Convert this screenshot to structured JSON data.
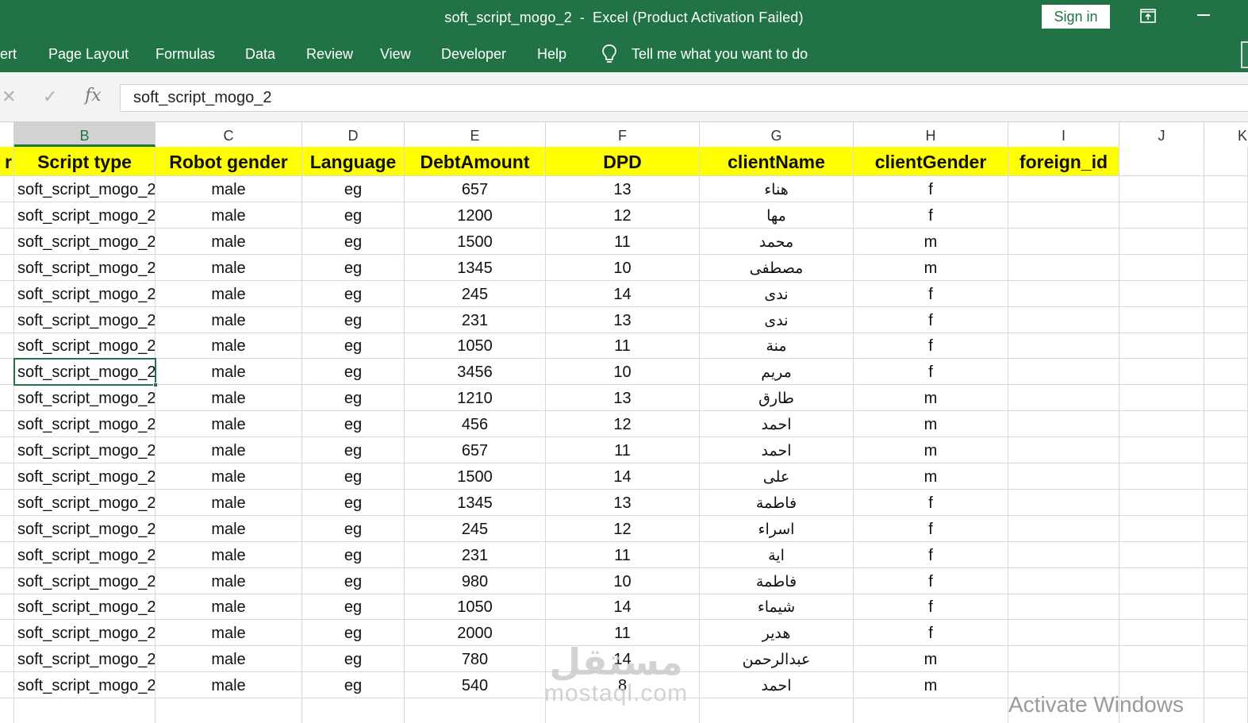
{
  "titlebar": {
    "file_name": "soft_script_mogo_2",
    "app_status": "Excel (Product Activation Failed)",
    "sign_in_label": "Sign in",
    "icons": [
      "restore-window-icon",
      "minimize-icon"
    ]
  },
  "ribbon": {
    "tabs": [
      "ert",
      "Page Layout",
      "Formulas",
      "Data",
      "Review",
      "View",
      "Developer",
      "Help"
    ],
    "tell_me": "Tell me what you want to do",
    "tell_me_icon": "lightbulb-icon"
  },
  "formula_bar": {
    "value": "soft_script_mogo_2",
    "cancel_icon": "cancel-x-icon",
    "enter_icon": "checkmark-icon",
    "fx_label": "fx"
  },
  "columns": [
    "B",
    "C",
    "D",
    "E",
    "F",
    "G",
    "H",
    "I",
    "J",
    "K"
  ],
  "selected_column": "B",
  "sheet": {
    "header_cut_left": "r",
    "headers": [
      "Script type",
      "Robot gender",
      "Language",
      "DebtAmount",
      "DPD",
      "clientName",
      "clientGender",
      "foreign_id"
    ],
    "rows": [
      [
        "soft_script_mogo_2",
        "male",
        "eg",
        "657",
        "13",
        "هناء",
        "f"
      ],
      [
        "soft_script_mogo_2",
        "male",
        "eg",
        "1200",
        "12",
        "مها",
        "f"
      ],
      [
        "soft_script_mogo_2",
        "male",
        "eg",
        "1500",
        "11",
        "محمد",
        "m"
      ],
      [
        "soft_script_mogo_2",
        "male",
        "eg",
        "1345",
        "10",
        "مصطفى",
        "m"
      ],
      [
        "soft_script_mogo_2",
        "male",
        "eg",
        "245",
        "14",
        "ندى",
        "f"
      ],
      [
        "soft_script_mogo_2",
        "male",
        "eg",
        "231",
        "13",
        "ندى",
        "f"
      ],
      [
        "soft_script_mogo_2",
        "male",
        "eg",
        "1050",
        "11",
        "منة",
        "f"
      ],
      [
        "soft_script_mogo_2",
        "male",
        "eg",
        "3456",
        "10",
        "مريم",
        "f"
      ],
      [
        "soft_script_mogo_2",
        "male",
        "eg",
        "1210",
        "13",
        "طارق",
        "m"
      ],
      [
        "soft_script_mogo_2",
        "male",
        "eg",
        "456",
        "12",
        "احمد",
        "m"
      ],
      [
        "soft_script_mogo_2",
        "male",
        "eg",
        "657",
        "11",
        "احمد",
        "m"
      ],
      [
        "soft_script_mogo_2",
        "male",
        "eg",
        "1500",
        "14",
        "على",
        "m"
      ],
      [
        "soft_script_mogo_2",
        "male",
        "eg",
        "1345",
        "13",
        "فاطمة",
        "f"
      ],
      [
        "soft_script_mogo_2",
        "male",
        "eg",
        "245",
        "12",
        "اسراء",
        "f"
      ],
      [
        "soft_script_mogo_2",
        "male",
        "eg",
        "231",
        "11",
        "اية",
        "f"
      ],
      [
        "soft_script_mogo_2",
        "male",
        "eg",
        "980",
        "10",
        "فاطمة",
        "f"
      ],
      [
        "soft_script_mogo_2",
        "male",
        "eg",
        "1050",
        "14",
        "شيماء",
        "f"
      ],
      [
        "soft_script_mogo_2",
        "male",
        "eg",
        "2000",
        "11",
        "هدير",
        "f"
      ],
      [
        "soft_script_mogo_2",
        "male",
        "eg",
        "780",
        "14",
        "عبدالرحمن",
        "m"
      ],
      [
        "soft_script_mogo_2",
        "male",
        "eg",
        "540",
        "8",
        "احمد",
        "m"
      ]
    ],
    "active_row_index": 7
  },
  "colors": {
    "excel_green": "#217346",
    "header_fill": "#ffff00"
  },
  "overlays": {
    "watermark_arabic": "مستقل",
    "watermark_latin": "mostaql.com",
    "activate_windows": "Activate Windows"
  }
}
